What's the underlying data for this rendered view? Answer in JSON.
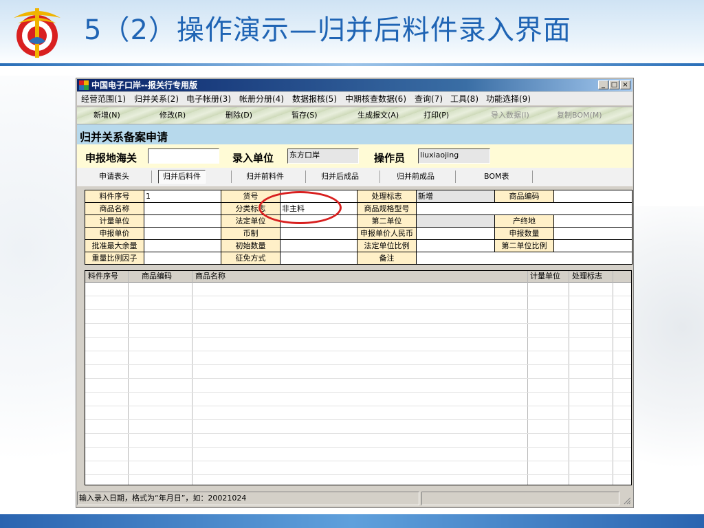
{
  "slide": {
    "title": "5（2）操作演示—归并后料件录入界面"
  },
  "window": {
    "title": "中国电子口岸--报关行专用版",
    "controls": {
      "minimize": "_",
      "maximize": "□",
      "close": "×"
    }
  },
  "menu": [
    "经营范围(1)",
    "归并关系(2)",
    "电子帐册(3)",
    "帐册分册(4)",
    "数据报核(5)",
    "中期核查数据(6)",
    "查询(7)",
    "工具(8)",
    "功能选择(9)"
  ],
  "toolbar": {
    "new": "新增(N)",
    "edit": "修改(R)",
    "delete": "删除(D)",
    "save": "暂存(S)",
    "generate": "生成报文(A)",
    "print": "打印(P)",
    "import": "导入数据(I)",
    "copy_bom": "复制BOM(M)"
  },
  "form": {
    "title": "归并关系备案申请",
    "customs_label": "申报地海关",
    "customs_value": "",
    "entry_unit_label": "录入单位",
    "entry_unit_value": "东方口岸",
    "operator_label": "操作员",
    "operator_value": "liuxiaojing"
  },
  "tabs": [
    "申请表头",
    "归并后料件",
    "归并前料件",
    "归并后成品",
    "归并前成品",
    "BOM表"
  ],
  "fields": {
    "item_no": "料件序号",
    "item_no_value": "1",
    "goods_no": "货号",
    "goods_no_value": "",
    "process_flag": "处理标志",
    "process_flag_value": "新增",
    "goods_code": "商品编码",
    "goods_code_value": "",
    "goods_name": "商品名称",
    "goods_name_value": "",
    "category_flag": "分类标志",
    "category_flag_value": "非主料",
    "spec_model": "商品规格型号",
    "spec_model_value": "",
    "unit": "计量单位",
    "unit_value": "",
    "legal_unit": "法定单位",
    "legal_unit_value": "",
    "second_unit": "第二单位",
    "second_unit_value": "",
    "origin": "产终地",
    "origin_value": "",
    "price": "申报单价",
    "price_value": "",
    "currency": "币制",
    "currency_value": "",
    "price_rmb": "申报单价人民币",
    "price_rmb_value": "",
    "declare_qty": "申报数量",
    "declare_qty_value": "",
    "max_remain": "批准最大余量",
    "max_remain_value": "",
    "init_qty": "初始数量",
    "init_qty_value": "",
    "legal_ratio": "法定单位比例",
    "legal_ratio_value": "",
    "second_ratio": "第二单位比例",
    "second_ratio_value": "",
    "weight_ratio": "重量比例因子",
    "weight_ratio_value": "",
    "tax_mode": "征免方式",
    "tax_mode_value": "",
    "note": "备注",
    "note_value": ""
  },
  "list": {
    "columns": [
      "料件序号",
      "商品编码",
      "商品名称",
      "计量单位",
      "处理标志"
    ]
  },
  "status": {
    "hint": "输入录入日期，格式为“年月日”，如：20021024",
    "panel2": ""
  },
  "colors": {
    "title_blue": "#1f64b4",
    "window_title": "#0a246a",
    "form_title_bg": "#b7d9ec",
    "header_bg": "#fffbd6",
    "label_bg": "#fff0c8",
    "annotation_red": "#d81f1f"
  }
}
